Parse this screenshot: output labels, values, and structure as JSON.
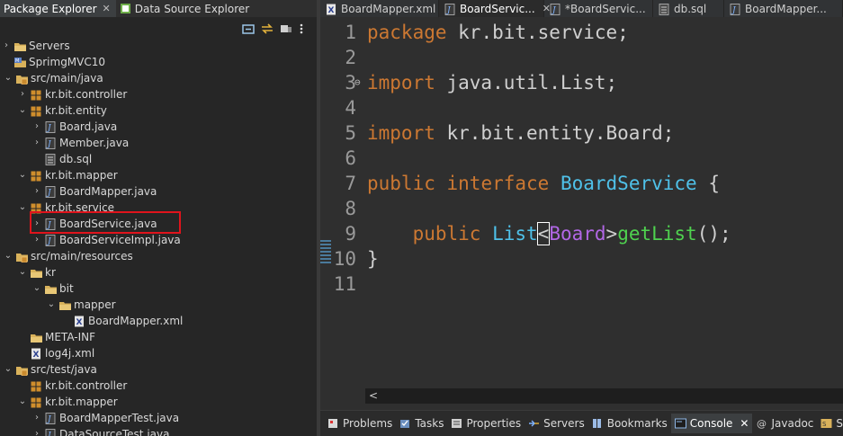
{
  "left_panel": {
    "tabs": [
      {
        "label": "Package Explorer",
        "close": "✕"
      },
      {
        "label": "Data Source Explorer"
      }
    ],
    "tree": [
      {
        "label": "Servers",
        "depth": 0,
        "twisty": "›",
        "icon": "folder"
      },
      {
        "label": "SprimgMVC10",
        "depth": 0,
        "twisty": "",
        "icon": "project"
      },
      {
        "label": "src/main/java",
        "depth": 1,
        "twisty": "⌄",
        "icon": "src-folder"
      },
      {
        "label": "kr.bit.controller",
        "depth": 2,
        "twisty": "›",
        "icon": "package"
      },
      {
        "label": "kr.bit.entity",
        "depth": 2,
        "twisty": "⌄",
        "icon": "package"
      },
      {
        "label": "Board.java",
        "depth": 3,
        "twisty": "›",
        "icon": "java-file"
      },
      {
        "label": "Member.java",
        "depth": 3,
        "twisty": "›",
        "icon": "java-file"
      },
      {
        "label": "db.sql",
        "depth": 3,
        "twisty": "",
        "icon": "sql-file"
      },
      {
        "label": "kr.bit.mapper",
        "depth": 2,
        "twisty": "⌄",
        "icon": "package"
      },
      {
        "label": "BoardMapper.java",
        "depth": 3,
        "twisty": "›",
        "icon": "java-file"
      },
      {
        "label": "kr.bit.service",
        "depth": 2,
        "twisty": "⌄",
        "icon": "package"
      },
      {
        "label": "BoardService.java",
        "depth": 3,
        "twisty": "›",
        "icon": "java-file"
      },
      {
        "label": "BoardServiceImpl.java",
        "depth": 3,
        "twisty": "›",
        "icon": "java-file"
      },
      {
        "label": "src/main/resources",
        "depth": 1,
        "twisty": "⌄",
        "icon": "src-folder"
      },
      {
        "label": "kr",
        "depth": 2,
        "twisty": "⌄",
        "icon": "folder"
      },
      {
        "label": "bit",
        "depth": 3,
        "twisty": "⌄",
        "icon": "folder"
      },
      {
        "label": "mapper",
        "depth": 4,
        "twisty": "⌄",
        "icon": "folder"
      },
      {
        "label": "BoardMapper.xml",
        "depth": 5,
        "twisty": "",
        "icon": "xml-file"
      },
      {
        "label": "META-INF",
        "depth": 2,
        "twisty": "",
        "icon": "folder"
      },
      {
        "label": "log4j.xml",
        "depth": 2,
        "twisty": "",
        "icon": "xml-file"
      },
      {
        "label": "src/test/java",
        "depth": 1,
        "twisty": "⌄",
        "icon": "src-folder"
      },
      {
        "label": "kr.bit.controller",
        "depth": 2,
        "twisty": "",
        "icon": "package"
      },
      {
        "label": "kr.bit.mapper",
        "depth": 2,
        "twisty": "⌄",
        "icon": "package"
      },
      {
        "label": "BoardMapperTest.java",
        "depth": 3,
        "twisty": "›",
        "icon": "java-file"
      },
      {
        "label": "DataSourceTest.java",
        "depth": 3,
        "twisty": "›",
        "icon": "java-file"
      }
    ],
    "highlighted_item": "BoardService.java"
  },
  "editor": {
    "tabs": [
      {
        "label": "BoardMapper.xml",
        "icon": "xml-file",
        "active": false
      },
      {
        "label": "BoardServic...",
        "icon": "java-file",
        "active": true,
        "close": "✕"
      },
      {
        "label": "*BoardServic...",
        "icon": "java-file",
        "active": false
      },
      {
        "label": "db.sql",
        "icon": "sql-file",
        "active": false
      },
      {
        "label": "BoardMapper...",
        "icon": "java-file",
        "active": false
      }
    ],
    "lines": [
      {
        "n": "1",
        "text": "package kr.bit.service;"
      },
      {
        "n": "2",
        "text": ""
      },
      {
        "n": "3",
        "fold": "⊖",
        "text": "import java.util.List;"
      },
      {
        "n": "4",
        "text": ""
      },
      {
        "n": "5",
        "text": "import kr.bit.entity.Board;"
      },
      {
        "n": "6",
        "text": ""
      },
      {
        "n": "7",
        "text": "public interface BoardService {"
      },
      {
        "n": "8",
        "text": ""
      },
      {
        "n": "9",
        "text": "    public List<Board>getList();"
      },
      {
        "n": "10",
        "text": "}"
      },
      {
        "n": "11",
        "text": ""
      }
    ],
    "hscroll_arrow": "<"
  },
  "bottom_views": {
    "tabs": [
      {
        "label": "Problems",
        "icon": "problems-icon"
      },
      {
        "label": "Tasks",
        "icon": "tasks-icon"
      },
      {
        "label": "Properties",
        "icon": "properties-icon"
      },
      {
        "label": "Servers",
        "icon": "servers-icon"
      },
      {
        "label": "Bookmarks",
        "icon": "bookmarks-icon"
      },
      {
        "label": "Console",
        "icon": "console-icon",
        "active": true,
        "close": "✕"
      },
      {
        "label": "Javadoc",
        "icon": "javadoc-icon"
      },
      {
        "label": "SV",
        "icon": "svn-icon"
      }
    ]
  }
}
